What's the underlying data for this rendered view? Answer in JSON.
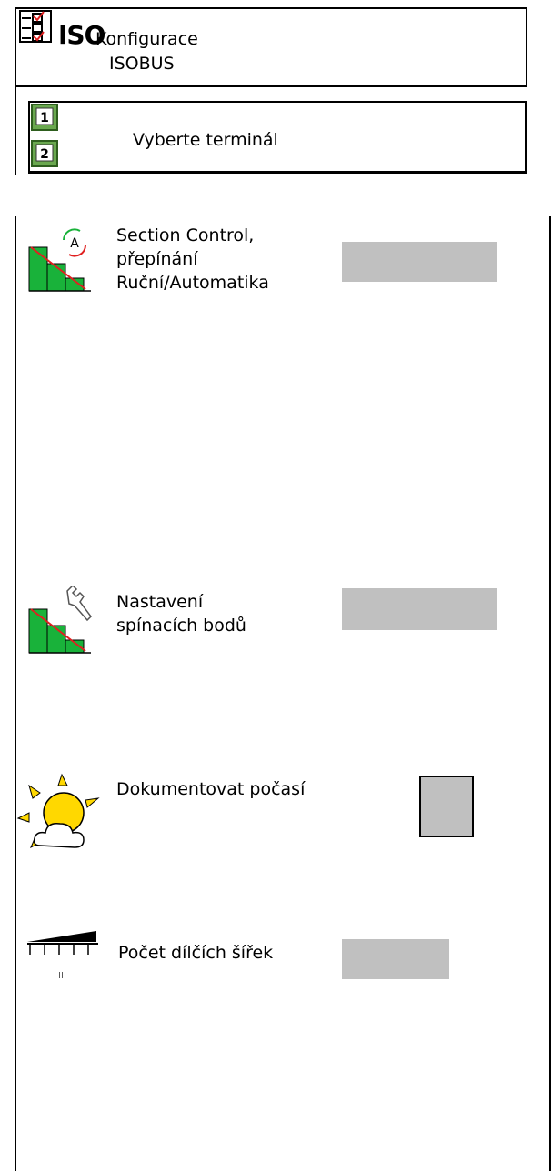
{
  "header": {
    "iso_badge": "ISO",
    "title_line1": "Konfigurace",
    "title_line2": "ISOBUS"
  },
  "terminal_select": {
    "terminal1_badge": "1",
    "terminal2_badge": "2",
    "label": "Vyberte terminál"
  },
  "settings": {
    "section_control": {
      "line1": "Section Control,",
      "line2": "přepínání",
      "line3": "Ruční/Automatika",
      "icon_letter": "A"
    },
    "switch_points": {
      "line1": "Nastavení",
      "line2": "spínacích bodů"
    },
    "weather": {
      "label": "Dokumentovat počasí"
    },
    "sections_count": {
      "label": "Počet dílčích šířek",
      "icon_mark": "II"
    }
  },
  "colors": {
    "field_gray": "#c0c0c0",
    "icon_green": "#19b23a",
    "sun_yellow": "#ffd800",
    "warning_red": "#e02020"
  },
  "icons": {
    "config": "config-list-icon",
    "terminal": "terminal-icon",
    "section_control": "section-control-auto-icon",
    "switch_points": "switch-points-wrench-icon",
    "weather": "sun-cloud-icon",
    "sections": "boom-sections-icon"
  }
}
